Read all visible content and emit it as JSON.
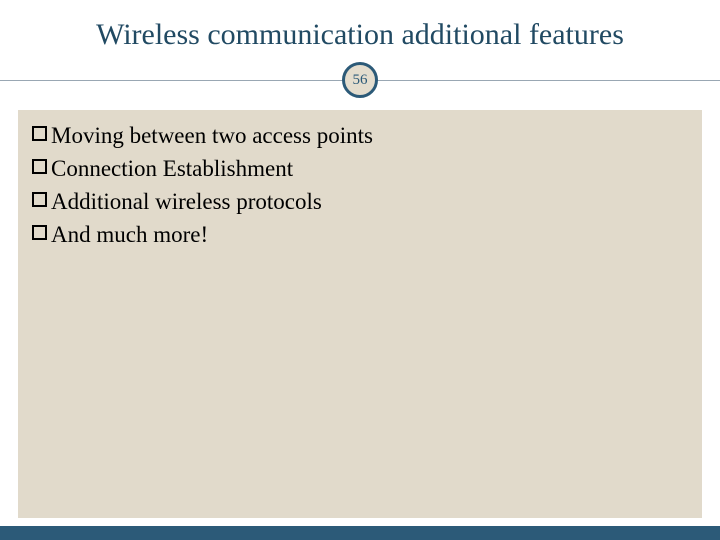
{
  "slide": {
    "title": "Wireless communication additional features",
    "page_number": "56",
    "bullets": [
      "Moving between two access points",
      "Connection Establishment",
      "Additional wireless protocols",
      "And much more!"
    ]
  },
  "colors": {
    "accent": "#2c5a78",
    "body_bg": "#e1dacb"
  }
}
